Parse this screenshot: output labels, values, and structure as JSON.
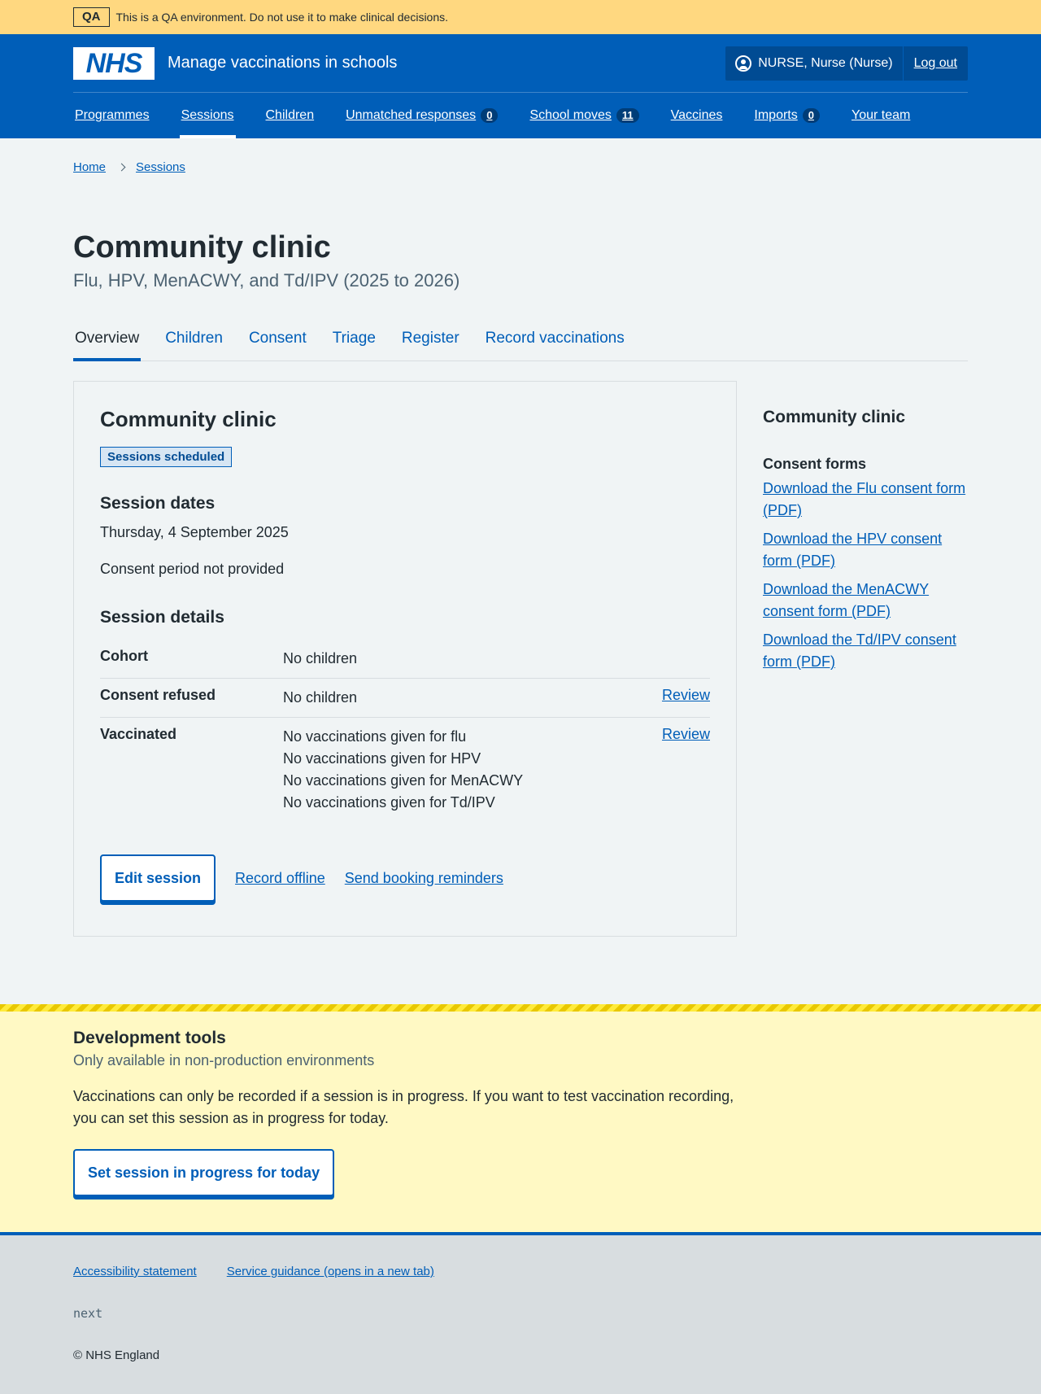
{
  "qa_banner": {
    "tag": "QA",
    "text": "This is a QA environment. Do not use it to make clinical decisions."
  },
  "header": {
    "logo_text": "NHS",
    "service_name": "Manage vaccinations in schools",
    "user_label": "NURSE, Nurse (Nurse)",
    "logout_label": "Log out"
  },
  "nav": {
    "programmes": "Programmes",
    "sessions": "Sessions",
    "children": "Children",
    "unmatched": "Unmatched responses",
    "unmatched_count": "0",
    "school_moves": "School moves",
    "school_moves_count": "11",
    "vaccines": "Vaccines",
    "imports": "Imports",
    "imports_count": "0",
    "your_team": "Your team"
  },
  "breadcrumb": {
    "home": "Home",
    "sessions": "Sessions"
  },
  "page": {
    "title": "Community clinic",
    "caption": "Flu, HPV, MenACWY, and Td/IPV (2025 to 2026)"
  },
  "tabs": {
    "overview": "Overview",
    "children": "Children",
    "consent": "Consent",
    "triage": "Triage",
    "register": "Register",
    "record": "Record vaccinations"
  },
  "card": {
    "title": "Community clinic",
    "status": "Sessions scheduled",
    "dates_heading": "Session dates",
    "date": "Thursday, 4 September 2025",
    "consent_period": "Consent period not provided",
    "details_heading": "Session details",
    "rows": {
      "cohort_label": "Cohort",
      "cohort_value": "No children",
      "refused_label": "Consent refused",
      "refused_value": "No children",
      "refused_action": "Review",
      "vaccinated_label": "Vaccinated",
      "vaccinated_values": [
        "No vaccinations given for flu",
        "No vaccinations given for HPV",
        "No vaccinations given for MenACWY",
        "No vaccinations given for Td/IPV"
      ],
      "vaccinated_action": "Review"
    },
    "edit_button": "Edit session",
    "record_offline": "Record offline",
    "send_reminders": "Send booking reminders"
  },
  "sidebar": {
    "title": "Community clinic",
    "consent_heading": "Consent forms",
    "links": [
      "Download the Flu consent form (PDF)",
      "Download the HPV consent form (PDF)",
      "Download the MenACWY consent form (PDF)",
      "Download the Td/IPV consent form (PDF)"
    ]
  },
  "devtools": {
    "title": "Development tools",
    "subtitle": "Only available in non-production environments",
    "text": "Vaccinations can only be recorded if a session is in progress. If you want to test vaccination recording, you can set this session as in progress for today.",
    "button": "Set session in progress for today"
  },
  "footer": {
    "accessibility": "Accessibility statement",
    "guidance": "Service guidance (opens in a new tab)",
    "version": "next",
    "copyright": "© NHS England"
  },
  "colors": {
    "nhs_blue": "#005eb8",
    "qa_banner": "#ffd880",
    "devtools_bg": "#fff9c4",
    "footer_bg": "#d8dde0"
  }
}
